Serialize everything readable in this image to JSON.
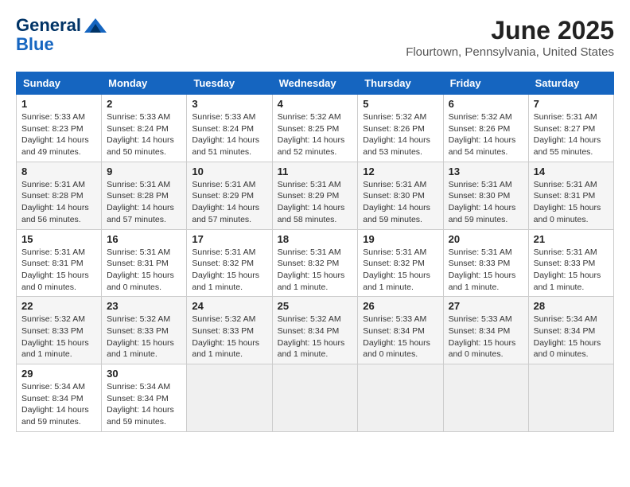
{
  "logo": {
    "general": "General",
    "blue": "Blue"
  },
  "title": "June 2025",
  "location": "Flourtown, Pennsylvania, United States",
  "headers": [
    "Sunday",
    "Monday",
    "Tuesday",
    "Wednesday",
    "Thursday",
    "Friday",
    "Saturday"
  ],
  "rows": [
    [
      {
        "day": "1",
        "sunrise": "Sunrise: 5:33 AM",
        "sunset": "Sunset: 8:23 PM",
        "daylight": "Daylight: 14 hours and 49 minutes."
      },
      {
        "day": "2",
        "sunrise": "Sunrise: 5:33 AM",
        "sunset": "Sunset: 8:24 PM",
        "daylight": "Daylight: 14 hours and 50 minutes."
      },
      {
        "day": "3",
        "sunrise": "Sunrise: 5:33 AM",
        "sunset": "Sunset: 8:24 PM",
        "daylight": "Daylight: 14 hours and 51 minutes."
      },
      {
        "day": "4",
        "sunrise": "Sunrise: 5:32 AM",
        "sunset": "Sunset: 8:25 PM",
        "daylight": "Daylight: 14 hours and 52 minutes."
      },
      {
        "day": "5",
        "sunrise": "Sunrise: 5:32 AM",
        "sunset": "Sunset: 8:26 PM",
        "daylight": "Daylight: 14 hours and 53 minutes."
      },
      {
        "day": "6",
        "sunrise": "Sunrise: 5:32 AM",
        "sunset": "Sunset: 8:26 PM",
        "daylight": "Daylight: 14 hours and 54 minutes."
      },
      {
        "day": "7",
        "sunrise": "Sunrise: 5:31 AM",
        "sunset": "Sunset: 8:27 PM",
        "daylight": "Daylight: 14 hours and 55 minutes."
      }
    ],
    [
      {
        "day": "8",
        "sunrise": "Sunrise: 5:31 AM",
        "sunset": "Sunset: 8:28 PM",
        "daylight": "Daylight: 14 hours and 56 minutes."
      },
      {
        "day": "9",
        "sunrise": "Sunrise: 5:31 AM",
        "sunset": "Sunset: 8:28 PM",
        "daylight": "Daylight: 14 hours and 57 minutes."
      },
      {
        "day": "10",
        "sunrise": "Sunrise: 5:31 AM",
        "sunset": "Sunset: 8:29 PM",
        "daylight": "Daylight: 14 hours and 57 minutes."
      },
      {
        "day": "11",
        "sunrise": "Sunrise: 5:31 AM",
        "sunset": "Sunset: 8:29 PM",
        "daylight": "Daylight: 14 hours and 58 minutes."
      },
      {
        "day": "12",
        "sunrise": "Sunrise: 5:31 AM",
        "sunset": "Sunset: 8:30 PM",
        "daylight": "Daylight: 14 hours and 59 minutes."
      },
      {
        "day": "13",
        "sunrise": "Sunrise: 5:31 AM",
        "sunset": "Sunset: 8:30 PM",
        "daylight": "Daylight: 14 hours and 59 minutes."
      },
      {
        "day": "14",
        "sunrise": "Sunrise: 5:31 AM",
        "sunset": "Sunset: 8:31 PM",
        "daylight": "Daylight: 15 hours and 0 minutes."
      }
    ],
    [
      {
        "day": "15",
        "sunrise": "Sunrise: 5:31 AM",
        "sunset": "Sunset: 8:31 PM",
        "daylight": "Daylight: 15 hours and 0 minutes."
      },
      {
        "day": "16",
        "sunrise": "Sunrise: 5:31 AM",
        "sunset": "Sunset: 8:31 PM",
        "daylight": "Daylight: 15 hours and 0 minutes."
      },
      {
        "day": "17",
        "sunrise": "Sunrise: 5:31 AM",
        "sunset": "Sunset: 8:32 PM",
        "daylight": "Daylight: 15 hours and 1 minute."
      },
      {
        "day": "18",
        "sunrise": "Sunrise: 5:31 AM",
        "sunset": "Sunset: 8:32 PM",
        "daylight": "Daylight: 15 hours and 1 minute."
      },
      {
        "day": "19",
        "sunrise": "Sunrise: 5:31 AM",
        "sunset": "Sunset: 8:32 PM",
        "daylight": "Daylight: 15 hours and 1 minute."
      },
      {
        "day": "20",
        "sunrise": "Sunrise: 5:31 AM",
        "sunset": "Sunset: 8:33 PM",
        "daylight": "Daylight: 15 hours and 1 minute."
      },
      {
        "day": "21",
        "sunrise": "Sunrise: 5:31 AM",
        "sunset": "Sunset: 8:33 PM",
        "daylight": "Daylight: 15 hours and 1 minute."
      }
    ],
    [
      {
        "day": "22",
        "sunrise": "Sunrise: 5:32 AM",
        "sunset": "Sunset: 8:33 PM",
        "daylight": "Daylight: 15 hours and 1 minute."
      },
      {
        "day": "23",
        "sunrise": "Sunrise: 5:32 AM",
        "sunset": "Sunset: 8:33 PM",
        "daylight": "Daylight: 15 hours and 1 minute."
      },
      {
        "day": "24",
        "sunrise": "Sunrise: 5:32 AM",
        "sunset": "Sunset: 8:33 PM",
        "daylight": "Daylight: 15 hours and 1 minute."
      },
      {
        "day": "25",
        "sunrise": "Sunrise: 5:32 AM",
        "sunset": "Sunset: 8:34 PM",
        "daylight": "Daylight: 15 hours and 1 minute."
      },
      {
        "day": "26",
        "sunrise": "Sunrise: 5:33 AM",
        "sunset": "Sunset: 8:34 PM",
        "daylight": "Daylight: 15 hours and 0 minutes."
      },
      {
        "day": "27",
        "sunrise": "Sunrise: 5:33 AM",
        "sunset": "Sunset: 8:34 PM",
        "daylight": "Daylight: 15 hours and 0 minutes."
      },
      {
        "day": "28",
        "sunrise": "Sunrise: 5:34 AM",
        "sunset": "Sunset: 8:34 PM",
        "daylight": "Daylight: 15 hours and 0 minutes."
      }
    ],
    [
      {
        "day": "29",
        "sunrise": "Sunrise: 5:34 AM",
        "sunset": "Sunset: 8:34 PM",
        "daylight": "Daylight: 14 hours and 59 minutes."
      },
      {
        "day": "30",
        "sunrise": "Sunrise: 5:34 AM",
        "sunset": "Sunset: 8:34 PM",
        "daylight": "Daylight: 14 hours and 59 minutes."
      },
      null,
      null,
      null,
      null,
      null
    ]
  ]
}
